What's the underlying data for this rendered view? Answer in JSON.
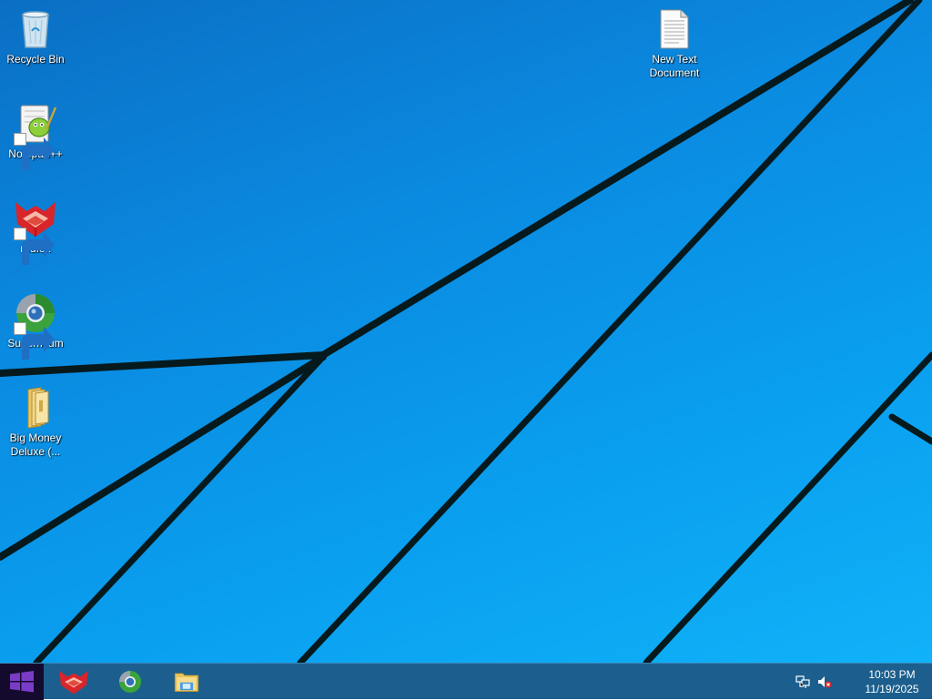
{
  "desktop": {
    "icons": [
      {
        "label": "Recycle Bin",
        "icon": "recycle-bin-icon",
        "shortcut": false
      },
      {
        "label": "Notepad++",
        "icon": "notepad-plus-plus-icon",
        "shortcut": true
      },
      {
        "label": "r3dfox",
        "icon": "r3dfox-icon",
        "shortcut": true
      },
      {
        "label": "Supermium",
        "icon": "supermium-icon",
        "shortcut": true
      },
      {
        "label": "Big Money Deluxe (...",
        "icon": "folder-icon",
        "shortcut": false
      },
      {
        "label": "New Text Document",
        "icon": "text-document-icon",
        "shortcut": false
      }
    ],
    "wallpaper_color": "#0a8ae0"
  },
  "taskbar": {
    "start": {
      "icon": "windows-logo-icon",
      "color": "#7a3cc6"
    },
    "pinned": [
      {
        "name": "r3dfox",
        "icon": "r3dfox-icon"
      },
      {
        "name": "Supermium",
        "icon": "supermium-icon"
      },
      {
        "name": "File Explorer",
        "icon": "file-explorer-icon"
      }
    ],
    "tray": {
      "network_icon": "network-icon",
      "volume_icon": "volume-muted-icon",
      "time": "10:03 PM",
      "date": "11/19/2025"
    }
  }
}
